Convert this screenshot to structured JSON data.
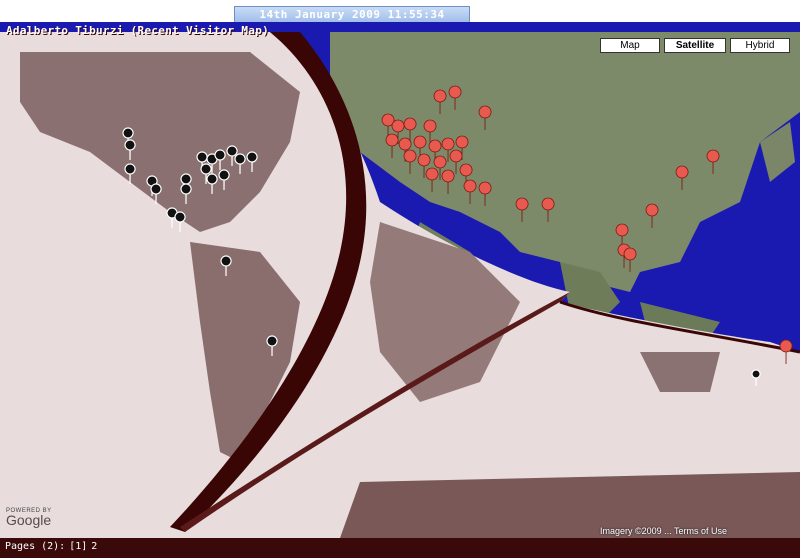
{
  "header": {
    "datetime": "14th January 2009 11:55:34"
  },
  "map": {
    "title": "Adalberto Tiburzi (Recent Visitor Map)",
    "controls": [
      "Map",
      "Satellite",
      "Hybrid"
    ],
    "active_control": "Satellite",
    "attribution": "Imagery ©2009 ... Terms of Use",
    "powered_by": "POWERED BY",
    "logo_text": "Google",
    "colors": {
      "ocean": "#1a1ab0",
      "land_satellite": "#7d8a6a",
      "curl_sepia": "#e8dcdc",
      "curl_dark": "#3a0505",
      "marker_red": "#e85a50",
      "marker_black": "#111111"
    },
    "visitor_markers_note": ""
  },
  "footer": {
    "pages_prefix": "Pages (2):",
    "pages_current": "[1]",
    "pages_next": "2"
  }
}
